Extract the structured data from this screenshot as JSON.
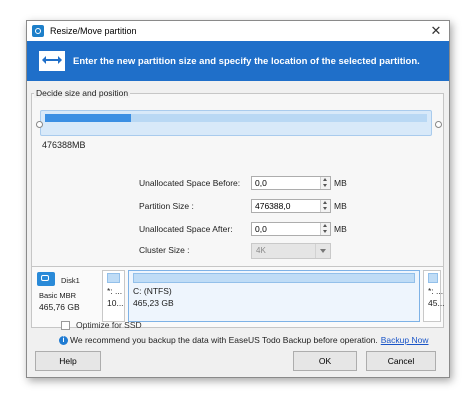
{
  "window": {
    "title": "Resize/Move partition",
    "close_glyph": "✕"
  },
  "banner": {
    "text": "Enter the new partition size and specify the location of the selected partition."
  },
  "group": {
    "title": "Decide size and position",
    "map_size_label": "476388MB"
  },
  "fields": {
    "unalloc_before": {
      "label": "Unallocated Space Before:",
      "value": "0,0",
      "unit": "MB"
    },
    "partition_size": {
      "label": "Partition Size :",
      "value": "476388,0",
      "unit": "MB"
    },
    "unalloc_after": {
      "label": "Unallocated Space After:",
      "value": "0,0",
      "unit": "MB"
    },
    "cluster_size": {
      "label": "Cluster Size :",
      "value": "4K"
    }
  },
  "disk": {
    "name": "Disk1",
    "type": "Basic MBR",
    "size": "465,76 GB",
    "partitions": [
      {
        "line1": "*: ...",
        "line2": "10..."
      },
      {
        "line1": "C: (NTFS)",
        "line2": "465,23 GB"
      },
      {
        "line1": "*: ...",
        "line2": "45..."
      }
    ]
  },
  "options": {
    "optimize_ssd_label": "Optimize for SSD",
    "optimize_ssd_checked": false
  },
  "info": {
    "text": "We recommend you backup the data with EaseUS Todo Backup before operation.",
    "link": "Backup Now"
  },
  "buttons": {
    "help": "Help",
    "ok": "OK",
    "cancel": "Cancel"
  },
  "colors": {
    "banner": "#1f6fc9",
    "accent": "#3b8fe3"
  },
  "icons": {
    "app": "easeus-app-icon",
    "banner": "resize-arrows-icon",
    "disk": "disk-icon",
    "info": "info-icon"
  }
}
